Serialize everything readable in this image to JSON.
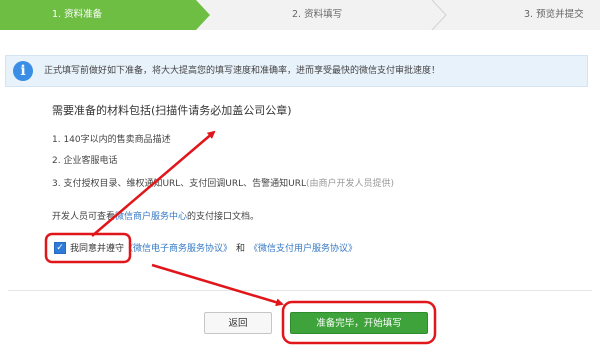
{
  "steps": [
    {
      "label": "1. 资料准备"
    },
    {
      "label": "2. 资料填写"
    },
    {
      "label": "3. 预览并提交"
    }
  ],
  "notice": {
    "icon": "info-icon",
    "icon_glyph": "i",
    "text": "正式填写前做好如下准备，将大大提高您的填写速度和准确率，进而享受最快的微信支付审批速度！"
  },
  "materials": {
    "title": "需要准备的材料包括(扫描件请务必加盖公司公章)",
    "items": [
      {
        "text": "1. 140字以内的售卖商品描述"
      },
      {
        "text": "2. 企业客服电话"
      },
      {
        "text": "3. 支付授权目录、维权通知URL、支付回调URL、告警通知URL",
        "hint": "(由商户开发人员提供)"
      }
    ]
  },
  "developer": {
    "prefix": "开发人员可查看",
    "link": "微信商户服务中心",
    "suffix": "的支付接口文档。"
  },
  "agreement": {
    "checked": true,
    "check_glyph": "✓",
    "label": "我同意并遵守",
    "link1": "《微信电子商务服务协议》",
    "and": "和",
    "link2": "《微信支付用户服务协议》"
  },
  "buttons": {
    "back": "返回",
    "next": "准备完毕，开始填写"
  },
  "colors": {
    "step_active": "#6fbe44",
    "primary_green": "#3ea33a",
    "annotation_red": "#e0161b",
    "link_blue": "#3679c4"
  }
}
